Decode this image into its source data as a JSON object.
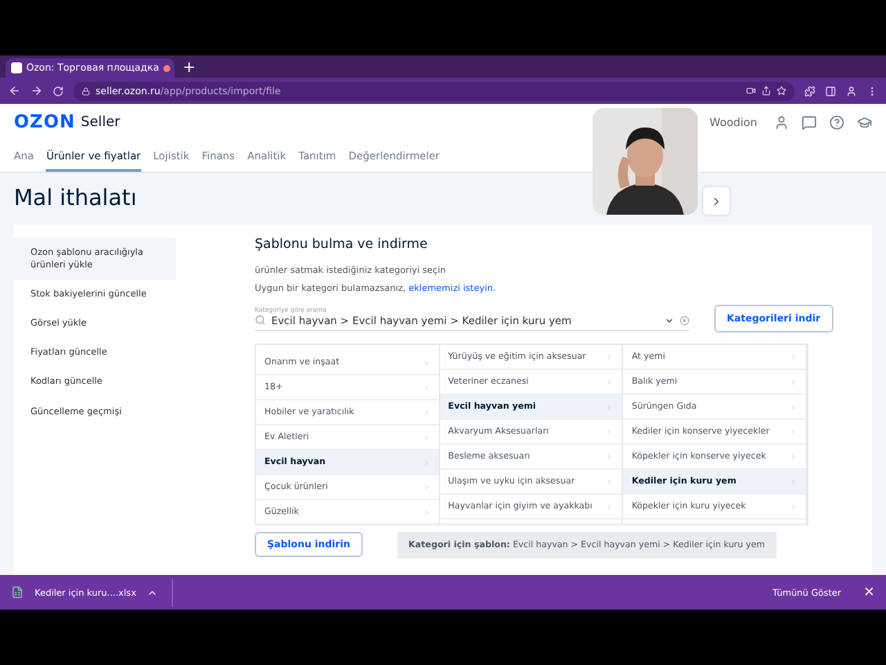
{
  "browser": {
    "tab_title": "Ozon: Торговая площадка",
    "recording": true,
    "new_tab": "+",
    "url_host": "seller.ozon.ru",
    "url_path": "/app/products/import/file"
  },
  "header": {
    "logo": "OZON",
    "logo_suffix": "Seller",
    "user": "Woodion",
    "nav": [
      {
        "label": "Ana",
        "selected": false
      },
      {
        "label": "Ürünler ve fiyatlar",
        "selected": true
      },
      {
        "label": "Lojistik",
        "selected": false
      },
      {
        "label": "Finans",
        "selected": false
      },
      {
        "label": "Analitik",
        "selected": false
      },
      {
        "label": "Tanıtım",
        "selected": false
      },
      {
        "label": "Değerlendirmeler",
        "selected": false
      }
    ]
  },
  "page_title": "Mal ithalatı",
  "sidebar": {
    "items": [
      {
        "label": "Ozon şablonu aracılığıyla ürünleri yükle",
        "selected": true
      },
      {
        "label": "Stok bakiyelerini güncelle",
        "selected": false
      },
      {
        "label": "Görsel yükle",
        "selected": false
      },
      {
        "label": "Fiyatları güncelle",
        "selected": false
      },
      {
        "label": "Kodları güncelle",
        "selected": false
      },
      {
        "label": "Güncelleme geçmişi",
        "selected": false
      }
    ]
  },
  "section": {
    "title": "Şablonu bulma ve indirme",
    "intro": "ürünler satmak istediğiniz kategoriyi seçin",
    "hint": "Uygun bir kategori bulamazsanız,",
    "hint_link": "eklememizi isteyin.",
    "search": {
      "label": "Kategoriye göre arama",
      "value": "Evcil hayvan > Evcil hayvan yemi > Kediler için kuru yem"
    },
    "download_categories": "Kategorileri indir",
    "columns": [
      {
        "items": [
          {
            "label": "Onarım ve inşaat",
            "selected": false
          },
          {
            "label": "18+",
            "selected": false
          },
          {
            "label": "Hobiler ve yaratıcılık",
            "selected": false
          },
          {
            "label": "Ev Aletleri",
            "selected": false
          },
          {
            "label": "Evcil hayvan",
            "selected": true
          },
          {
            "label": "Çocuk ürünleri",
            "selected": false
          },
          {
            "label": "Güzellik",
            "selected": false
          }
        ]
      },
      {
        "items": [
          {
            "label": "Yürüyüş ve eğitim için aksesuar",
            "selected": false
          },
          {
            "label": "Veteriner eczanesi",
            "selected": false
          },
          {
            "label": "Evcil hayvan yemi",
            "selected": true
          },
          {
            "label": "Akvaryum Aksesuarları",
            "selected": false
          },
          {
            "label": "Besleme aksesuarı",
            "selected": false
          },
          {
            "label": "Ulaşım ve uyku için aksesuar",
            "selected": false
          },
          {
            "label": "Hayvanlar için giyim ve ayakkabı",
            "selected": false
          }
        ]
      },
      {
        "items": [
          {
            "label": "At yemi",
            "selected": false
          },
          {
            "label": "Balık yemi",
            "selected": false
          },
          {
            "label": "Sürüngen Gıda",
            "selected": false
          },
          {
            "label": "Kediler için konserve yiyecekler",
            "selected": false
          },
          {
            "label": "Köpekler için konserve yiyecek",
            "selected": false
          },
          {
            "label": "Kediler için kuru yem",
            "selected": true
          },
          {
            "label": "Köpekler için kuru yiyecek",
            "selected": false
          }
        ]
      }
    ],
    "download_template": "Şablonu indirin",
    "template_info": "**Kategori için şablon:** Evcil hayvan > Evcil hayvan yemi > Kediler için kuru yem"
  },
  "download_bar": {
    "file": "Kediler için kuru....xlsx",
    "show_all": "Tümünü Göster",
    "close": "×"
  }
}
